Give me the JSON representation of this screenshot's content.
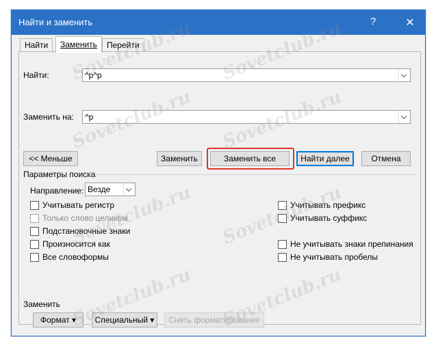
{
  "window": {
    "title": "Найти и заменить",
    "help": "?",
    "close": "✕"
  },
  "tabs": [
    {
      "label": "Найти"
    },
    {
      "label": "Заменить"
    },
    {
      "label": "Перейти"
    }
  ],
  "find": {
    "label": "Найти:",
    "value": "^p^p"
  },
  "replace": {
    "label": "Заменить на:",
    "value": "^p"
  },
  "buttons": {
    "less": "<< Меньше",
    "replace": "Заменить",
    "replace_all": "Заменить все",
    "find_next": "Найти далее",
    "cancel": "Отмена"
  },
  "search_options": {
    "title": "Параметры поиска",
    "direction_label": "Направление:",
    "direction_value": "Везде",
    "left": [
      {
        "label": "Учитывать регистр",
        "checked": false,
        "disabled": false
      },
      {
        "label": "Только слово целиком",
        "checked": false,
        "disabled": true
      },
      {
        "label": "Подстановочные знаки",
        "checked": false,
        "disabled": false
      },
      {
        "label": "Произносится как",
        "checked": false,
        "disabled": false
      },
      {
        "label": "Все словоформы",
        "checked": false,
        "disabled": false
      }
    ],
    "right": [
      {
        "label": "Учитывать префикс",
        "checked": false
      },
      {
        "label": "Учитывать суффикс",
        "checked": false
      },
      {
        "label": "Не учитывать знаки препинания",
        "checked": false
      },
      {
        "label": "Не учитывать пробелы",
        "checked": false
      }
    ]
  },
  "replace_section": {
    "title": "Заменить",
    "format": "Формат ▾",
    "special": "Специальный ▾",
    "clear_format": "Снять форматирование"
  },
  "watermark": "Sovetclub.ru"
}
